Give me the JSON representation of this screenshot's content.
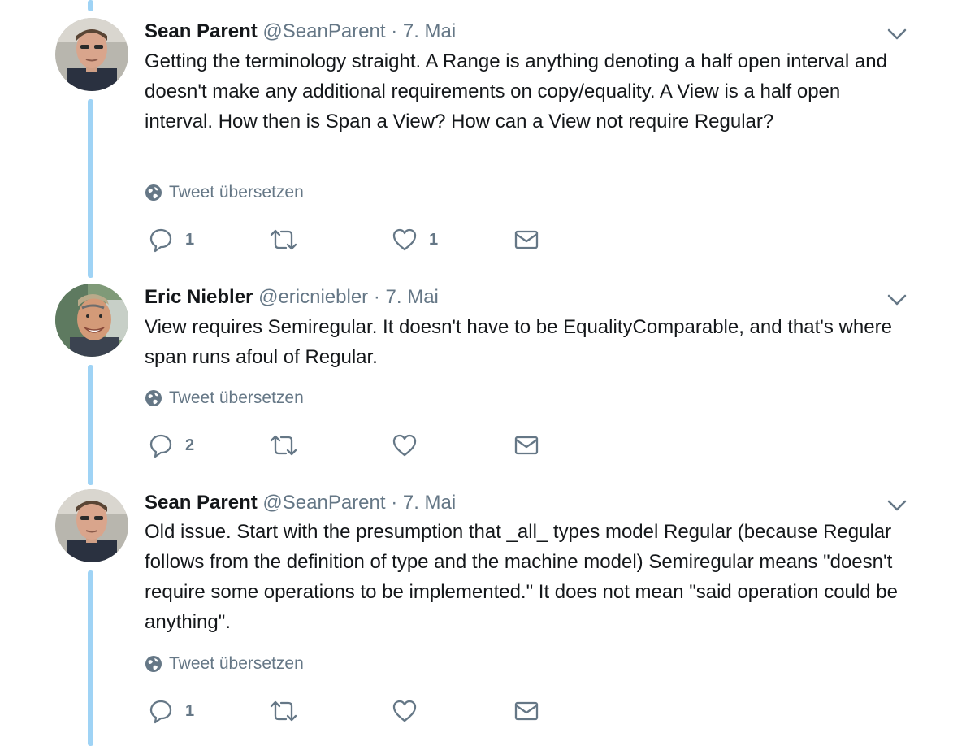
{
  "thread": [
    {
      "name": "Sean Parent",
      "handle": "@SeanParent",
      "separator": "·",
      "date": "7. Mai",
      "avatar": "avatar-sean",
      "text": "Getting the terminology straight. A Range is anything denoting a half open interval and doesn't make any additional requirements on copy/equality. A View is a half open interval. How then is Span a View? How can a View not require Regular?",
      "translate_label": "Tweet übersetzen",
      "replies": "1",
      "retweets": "",
      "likes": "1"
    },
    {
      "name": "Eric Niebler",
      "handle": "@ericniebler",
      "separator": "·",
      "date": "7. Mai",
      "avatar": "avatar-eric",
      "text": "View requires Semiregular. It doesn't have to be EqualityComparable, and that's where span runs afoul of Regular.",
      "translate_label": "Tweet übersetzen",
      "replies": "2",
      "retweets": "",
      "likes": ""
    },
    {
      "name": "Sean Parent",
      "handle": "@SeanParent",
      "separator": "·",
      "date": "7. Mai",
      "avatar": "avatar-sean",
      "text": "Old issue. Start with the presumption that _all_ types model Regular (because Regular follows from the definition of type and the machine model) Semiregular means \"doesn't require some operations to be implemented.\" It does not mean \"said operation could be anything\".",
      "translate_label": "Tweet übersetzen",
      "replies": "1",
      "retweets": "",
      "likes": ""
    }
  ],
  "icons": {
    "reply": "reply-icon",
    "retweet": "retweet-icon",
    "like": "heart-icon",
    "dm": "envelope-icon",
    "translate": "globe-icon",
    "menu": "chevron-down-icon"
  },
  "colors": {
    "thread_line": "#9fd3f5",
    "text": "#14171a",
    "secondary": "#657786"
  }
}
